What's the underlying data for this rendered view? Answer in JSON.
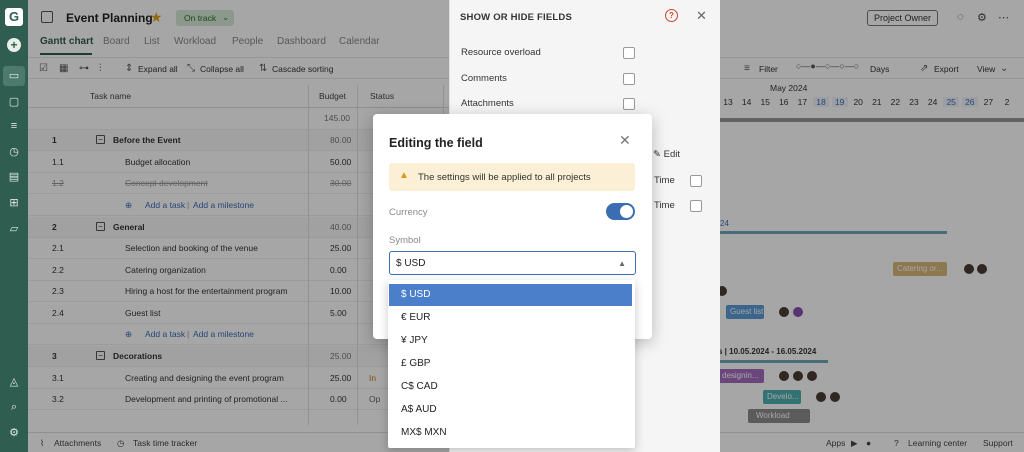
{
  "project": {
    "title": "Event Planning",
    "status": "On track",
    "owner_button": "Project Owner"
  },
  "tabs": [
    "Gantt chart",
    "Board",
    "List",
    "Workload",
    "People",
    "Dashboard",
    "Calendar"
  ],
  "toolbar": {
    "expand_all": "Expand all",
    "collapse_all": "Collapse all",
    "cascade_sorting": "Cascade sorting",
    "filter": "Filter",
    "days": "Days",
    "export": "Export",
    "view": "View"
  },
  "grid": {
    "headers": {
      "task_name": "Task name",
      "budget": "Budget",
      "status": "Status"
    },
    "total_budget": "145.00",
    "rows": [
      {
        "num": "1",
        "name": "Before the Event",
        "budget": "80.00",
        "group": true
      },
      {
        "num": "1.1",
        "name": "Budget allocation",
        "budget": "50.00"
      },
      {
        "num": "1.2",
        "name": "Concept development",
        "budget": "30.00",
        "done": true
      },
      {
        "add": true
      },
      {
        "num": "2",
        "name": "General",
        "budget": "40.00",
        "group": true
      },
      {
        "num": "2.1",
        "name": "Selection and booking of the venue",
        "budget": "25.00"
      },
      {
        "num": "2.2",
        "name": "Catering organization",
        "budget": "0.00"
      },
      {
        "num": "2.3",
        "name": "Hiring a host for the entertainment program",
        "budget": "10.00"
      },
      {
        "num": "2.4",
        "name": "Guest list",
        "budget": "5.00"
      },
      {
        "add": true
      },
      {
        "num": "3",
        "name": "Decorations",
        "budget": "25.00",
        "group": true
      },
      {
        "num": "3.1",
        "name": "Creating and designing the event program",
        "budget": "25.00",
        "status": "In"
      },
      {
        "num": "3.2",
        "name": "Development and printing of promotional ...",
        "budget": "0.00",
        "status": "Op"
      }
    ],
    "add_task": "Add a task",
    "add_milestone": "Add a milestone"
  },
  "gantt": {
    "month": "May 2024",
    "days": [
      "13",
      "14",
      "15",
      "16",
      "17",
      "18",
      "19",
      "20",
      "21",
      "22",
      "23",
      "24",
      "25",
      "26",
      "27",
      "2"
    ],
    "weekend_days": [
      "18",
      "19",
      "25",
      "26"
    ],
    "bars": {
      "catering": "Catering or...",
      "guest": "Guest list",
      "design": "designin...",
      "develo": "Develo...",
      "workload": "Workload",
      "range": "s | 10.05.2024 - 16.05.2024",
      "label_24": "24"
    }
  },
  "bottom": {
    "attachments": "Attachments",
    "tracker": "Task time tracker",
    "apps": "Apps",
    "learning": "Learning center",
    "support": "Support"
  },
  "fields_panel": {
    "title": "SHOW OR HIDE FIELDS",
    "items": [
      "Resource overload",
      "Comments",
      "Attachments"
    ],
    "edit": "Edit",
    "time1": "Time",
    "time2": "Time"
  },
  "modal": {
    "title": "Editing the field",
    "warning": "The settings will be applied to all projects",
    "currency_label": "Currency",
    "symbol_label": "Symbol",
    "symbol_value": "$ USD"
  },
  "dropdown": {
    "options": [
      "$ USD",
      "€ EUR",
      "¥ JPY",
      "£ GBP",
      "C$ CAD",
      "A$ AUD",
      "MX$ MXN"
    ],
    "selected": "$ USD"
  },
  "colors": {
    "sidebar": "#2f5d50",
    "accent": "#3b6db3",
    "warning_bg": "#fbefd6",
    "selected_option": "#4c7fc9"
  }
}
